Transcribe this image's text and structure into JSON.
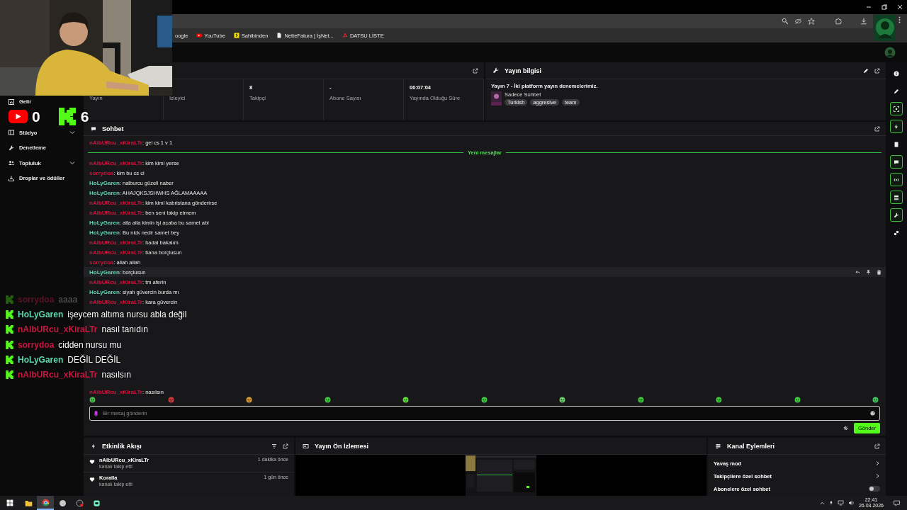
{
  "browser": {
    "bookmarks": [
      {
        "kind": "plain",
        "label": "oogle"
      },
      {
        "kind": "youtube",
        "label": "YouTube"
      },
      {
        "kind": "sahibinden",
        "label": "Sahibinden"
      },
      {
        "kind": "page",
        "label": "NetteFatura | İşNet..."
      },
      {
        "kind": "pdf",
        "label": "DATSU LİSTE"
      }
    ]
  },
  "sidebar": {
    "items": [
      {
        "kind": "chart",
        "label": "Gelir",
        "expandable": false
      },
      {
        "kind": "studio",
        "label": "Stüdyo",
        "expandable": true
      },
      {
        "kind": "wrench",
        "label": "Denetleme",
        "expandable": false
      },
      {
        "kind": "people",
        "label": "Topluluk",
        "expandable": true
      },
      {
        "kind": "drops",
        "label": "Droplar ve ödüller",
        "expandable": false
      }
    ]
  },
  "counters": [
    {
      "kind": "youtube",
      "count": "0"
    },
    {
      "kind": "kick",
      "count": "6"
    }
  ],
  "stats": {
    "cells": [
      {
        "label": "Yayın"
      },
      {
        "label": "İzleyici"
      },
      {
        "value": "8",
        "label": "Takipçi"
      },
      {
        "value": "-",
        "label": "Abone Sayısı"
      },
      {
        "value": "00:07:04",
        "label": "Yayında Olduğu Süre"
      }
    ]
  },
  "stream_info": {
    "title": "Yayın bilgisi",
    "stream_title": "Yayın 7 - İki platform yayın denemelerimiz.",
    "category": "Sadece Sohbet",
    "tags": [
      "Turkish",
      "aggresive",
      "team"
    ]
  },
  "chat": {
    "title": "Sohbet",
    "divider": "Yeni mesajlar",
    "earlier_messages": [
      {
        "user": "nAlbURcu_xKiraLTr",
        "color": "#c8163f",
        "text": ": gel cs 1 v 1",
        "hovered": false
      }
    ],
    "new_messages": [
      {
        "user": "nAlbURcu_xKiraLTr",
        "color": "#c8163f",
        "text": ": kim kimi yerse",
        "hovered": false
      },
      {
        "user": "sorrydoa",
        "color": "#c8163f",
        "text": ": kim bu cs ci",
        "hovered": false
      },
      {
        "user": "HoLyGaren",
        "color": "#5cd6ae",
        "text": ": nalburcu güzeli naber",
        "hovered": false
      },
      {
        "user": "HoLyGaren",
        "color": "#5cd6ae",
        "text": ": AHAJQKSJSHWHS AĞLAMAAAAA",
        "hovered": false
      },
      {
        "user": "nAlbURcu_xKiraLTr",
        "color": "#c8163f",
        "text": ": kim kimi kabristana gönderirse",
        "hovered": false
      },
      {
        "user": "nAlbURcu_xKiraLTr",
        "color": "#c8163f",
        "text": ": ben seni takip etmem",
        "hovered": false
      },
      {
        "user": "HoLyGaren",
        "color": "#5cd6ae",
        "text": ": alla alla kimin işi acaba bu samet abi",
        "hovered": false
      },
      {
        "user": "HoLyGaren",
        "color": "#5cd6ae",
        "text": ": Bu nick nedir samet bey",
        "hovered": false
      },
      {
        "user": "nAlbURcu_xKiraLTr",
        "color": "#c8163f",
        "text": ": hadal bakalım",
        "hovered": false
      },
      {
        "user": "nAlbURcu_xKiraLTr",
        "color": "#c8163f",
        "text": ": bana borçlusun",
        "hovered": false
      },
      {
        "user": "sorrydoa",
        "color": "#c8163f",
        "text": ": allah allah",
        "hovered": false
      },
      {
        "user": "HoLyGaren",
        "color": "#5cd6ae",
        "text": ": borçlusun",
        "hovered": true
      },
      {
        "user": "nAlbURcu_xKiraLTr",
        "color": "#c8163f",
        "text": ": tm aferin",
        "hovered": false
      },
      {
        "user": "HoLyGaren",
        "color": "#5cd6ae",
        "text": ": siyah güvercin burda mı",
        "hovered": false
      },
      {
        "user": "nAlbURcu_xKiraLTr",
        "color": "#c8163f",
        "text": ": kara güvercin",
        "hovered": false
      }
    ],
    "last_message": {
      "user": "nAlbURcu_xKiraLTr",
      "color": "#c8163f",
      "text": ": nasılsın",
      "hovered": false
    },
    "placeholder": "Bir mesaj gönderin",
    "send": "Gönder"
  },
  "overlay_chat": [
    {
      "user": "sorrydoa",
      "color": "#5a1424",
      "text": "aaaa",
      "faded": true
    },
    {
      "user": "HoLyGaren",
      "color": "#5cd6ae",
      "text": "işeycem altıma nursu abla değil",
      "faded": false
    },
    {
      "user": "nAlbURcu_xKiraLTr",
      "color": "#c8163f",
      "text": "nasıl tanıdın",
      "faded": false
    },
    {
      "user": "sorrydoa",
      "color": "#c8163f",
      "text": "cidden nursu mu",
      "faded": false
    },
    {
      "user": "HoLyGaren",
      "color": "#5cd6ae",
      "text": "DEĞİL DEĞİL",
      "faded": false
    },
    {
      "user": "nAlbURcu_xKiraLTr",
      "color": "#c8163f",
      "text": "nasılsın",
      "faded": false
    }
  ],
  "events": {
    "title": "Etkinlik Akışı",
    "items": [
      {
        "name": "nAlbURcu_xKiraLTr",
        "action": "kanalı takip etti",
        "time": "1 dakika önce"
      },
      {
        "name": "Koralla",
        "action": "kanalı takip etti",
        "time": "1 gün önce"
      }
    ]
  },
  "preview": {
    "title": "Yayın Ön İzlemesi"
  },
  "channel_actions": {
    "title": "Kanal Eylemleri",
    "items": [
      {
        "kind": "link",
        "label": "Yavaş mod"
      },
      {
        "kind": "link",
        "label": "Takipçilere özel sohbet"
      },
      {
        "kind": "toggle",
        "label": "Abonelere özel sohbet",
        "on": false
      }
    ]
  },
  "tool_rail": [
    {
      "kind": "info",
      "highlighted": false
    },
    {
      "kind": "pencil",
      "highlighted": false
    },
    {
      "kind": "focus",
      "highlighted": true
    },
    {
      "kind": "bolt",
      "highlighted": true
    },
    {
      "kind": "card",
      "highlighted": false
    },
    {
      "kind": "chat",
      "highlighted": true
    },
    {
      "kind": "broadcast",
      "highlighted": true
    },
    {
      "kind": "stack",
      "highlighted": true
    },
    {
      "kind": "wrench",
      "highlighted": true
    },
    {
      "kind": "drops",
      "highlighted": false
    }
  ],
  "taskbar": {
    "apps": [
      {
        "kind": "explorer",
        "active": false
      },
      {
        "kind": "chrome",
        "active": true
      },
      {
        "kind": "app",
        "active": false
      },
      {
        "kind": "recorder",
        "active": false
      },
      {
        "kind": "chat",
        "active": false
      }
    ],
    "time": "22:41",
    "date": "26.03.2026"
  }
}
